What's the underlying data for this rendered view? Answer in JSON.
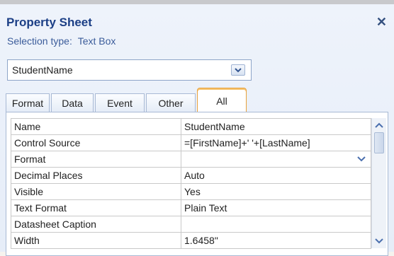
{
  "header": {
    "title": "Property Sheet",
    "selection_label": "Selection type:",
    "selection_value": "Text Box"
  },
  "object_combo": {
    "value": "StudentName"
  },
  "tabs": [
    {
      "label": "Format",
      "active": false
    },
    {
      "label": "Data",
      "active": false
    },
    {
      "label": "Event",
      "active": false
    },
    {
      "label": "Other",
      "active": false
    },
    {
      "label": "All",
      "active": true
    }
  ],
  "properties": [
    {
      "name": "Name",
      "value": "StudentName"
    },
    {
      "name": "Control Source",
      "value": "=[FirstName]+' '+[LastName]"
    },
    {
      "name": "Format",
      "value": ""
    },
    {
      "name": "Decimal Places",
      "value": "Auto"
    },
    {
      "name": "Visible",
      "value": "Yes"
    },
    {
      "name": "Text Format",
      "value": "Plain Text"
    },
    {
      "name": "Datasheet Caption",
      "value": ""
    },
    {
      "name": "Width",
      "value": "1.6458\""
    }
  ],
  "colors": {
    "title": "#1c3f86",
    "active_tab_border": "#e8a13b",
    "panel_bg": "#e6edf8"
  },
  "icons": [
    "close-icon",
    "chevron-down-icon",
    "scroll-up-icon",
    "scroll-down-icon"
  ]
}
